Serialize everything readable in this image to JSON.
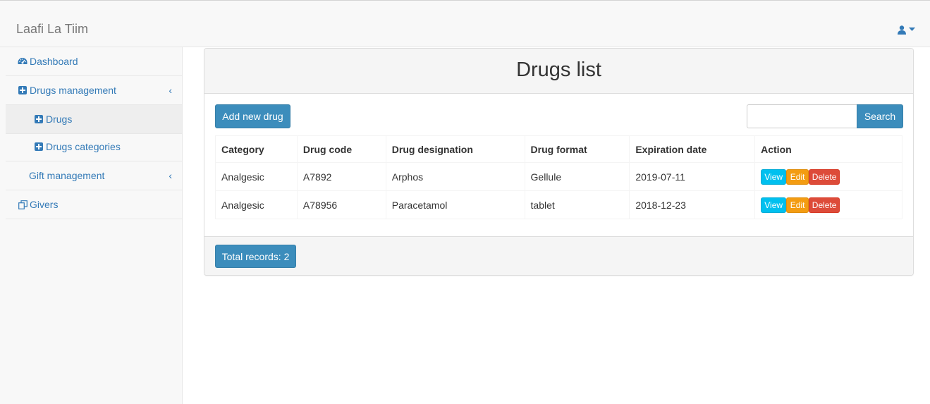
{
  "app": {
    "brand": "Laafi La Tiim"
  },
  "header": {
    "user_icon": "user-icon",
    "caret_icon": "caret-down-icon"
  },
  "sidebar": {
    "items": [
      {
        "label": "Dashboard",
        "icon": "dashboard-icon"
      },
      {
        "label": "Drugs management",
        "icon": "plus-square-icon",
        "chevron": "‹"
      },
      {
        "label": "Drugs",
        "icon": "plus-square-icon",
        "active": true
      },
      {
        "label": "Drugs categories",
        "icon": "plus-square-icon"
      },
      {
        "label": "Gift management",
        "chevron": "‹"
      },
      {
        "label": "Givers",
        "icon": "copy-icon"
      }
    ]
  },
  "main": {
    "title": "Drugs list",
    "add_label": "Add new drug",
    "search": {
      "button": "Search",
      "value": "",
      "placeholder": ""
    },
    "table": {
      "headers": [
        "Category",
        "Drug code",
        "Drug designation",
        "Drug format",
        "Expiration date",
        "Action"
      ],
      "rows": [
        [
          "Analgesic",
          "A7892",
          "Arphos",
          "Gellule",
          "2019-07-11"
        ],
        [
          "Analgesic",
          "A78956",
          "Paracetamol",
          "tablet",
          "2018-12-23"
        ]
      ],
      "actions": {
        "view": "View",
        "edit": "Edit",
        "delete": "Delete"
      }
    },
    "footer": {
      "total_label": "Total records: 2"
    }
  },
  "colors": {
    "primary": "#3c8dbc",
    "link": "#337ab7",
    "view": "#00c0ef",
    "edit": "#f39c12",
    "delete": "#dd4b39"
  }
}
